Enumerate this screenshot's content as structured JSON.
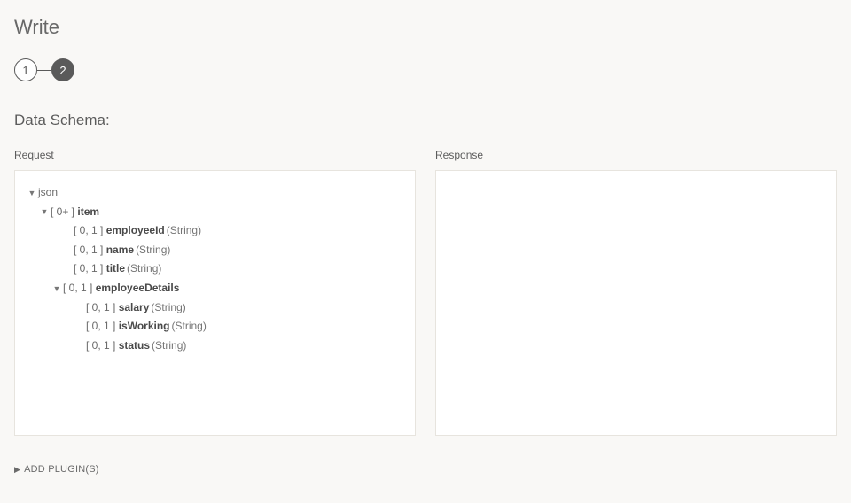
{
  "page": {
    "title": "Write",
    "schemaTitle": "Data Schema:",
    "addPlugins": "ADD PLUGIN(S)"
  },
  "steps": {
    "s1": "1",
    "s2": "2"
  },
  "columns": {
    "request": "Request",
    "response": "Response"
  },
  "tree": {
    "root": "json",
    "item": {
      "card": "[ 0+ ]",
      "name": "item"
    },
    "employeeId": {
      "card": "[ 0, 1 ]",
      "name": "employeeId",
      "type": "(String)"
    },
    "name": {
      "card": "[ 0, 1 ]",
      "name": "name",
      "type": "(String)"
    },
    "title": {
      "card": "[ 0, 1 ]",
      "name": "title",
      "type": "(String)"
    },
    "employeeDetails": {
      "card": "[ 0, 1 ]",
      "name": "employeeDetails"
    },
    "salary": {
      "card": "[ 0, 1 ]",
      "name": "salary",
      "type": "(String)"
    },
    "isWorking": {
      "card": "[ 0, 1 ]",
      "name": "isWorking",
      "type": "(String)"
    },
    "status": {
      "card": "[ 0, 1 ]",
      "name": "status",
      "type": "(String)"
    }
  }
}
